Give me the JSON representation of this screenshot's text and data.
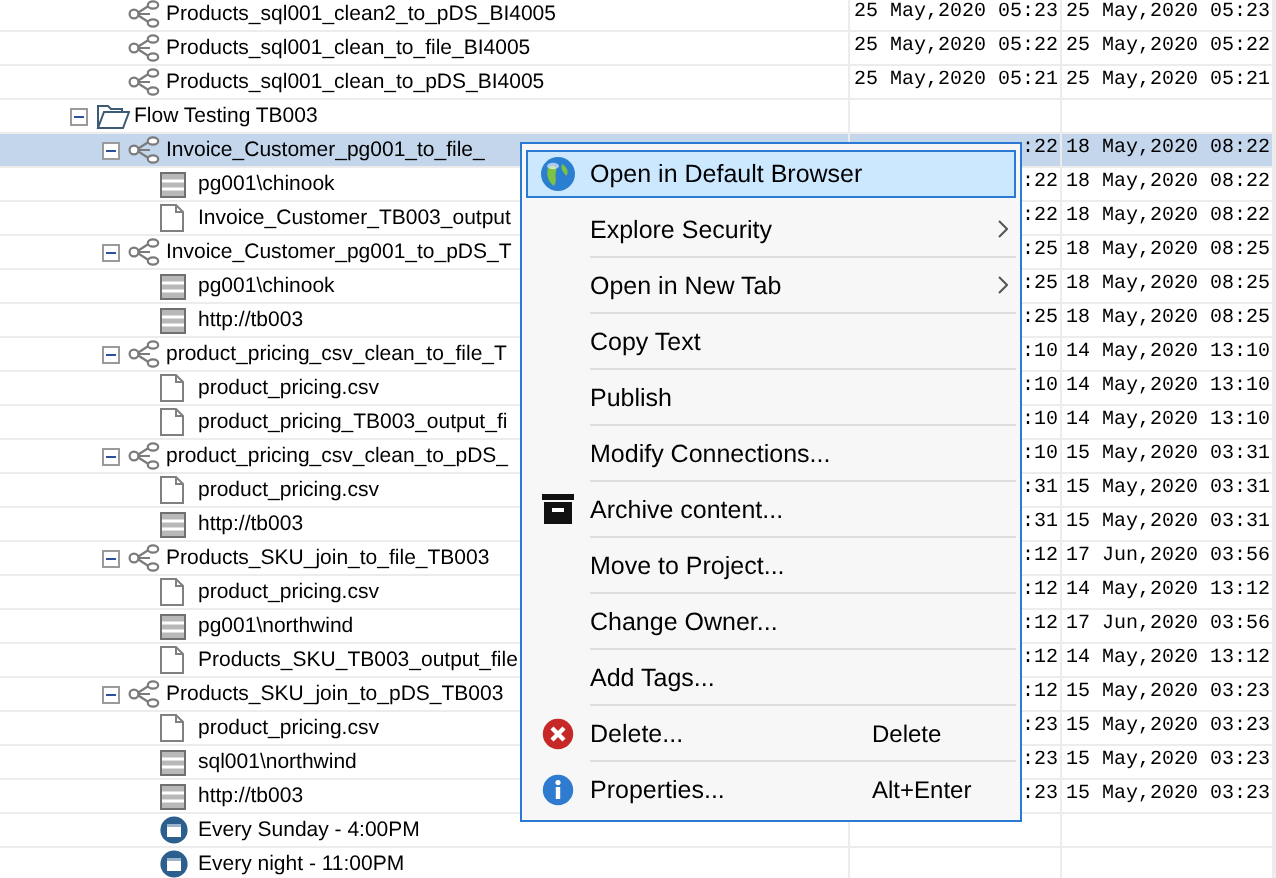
{
  "tree": [
    {
      "children": [
        {
          "kind": "flow",
          "label": "Products_sql001_clean2_to_pDS_BI4005",
          "selected": false,
          "created": "25 May,2020 05:23",
          "modified": "25 May,2020 05:23"
        },
        {
          "kind": "flow",
          "label": "Products_sql001_clean_to_file_BI4005",
          "selected": false,
          "created": "25 May,2020 05:22",
          "modified": "25 May,2020 05:22"
        },
        {
          "kind": "flow",
          "label": "Products_sql001_clean_to_pDS_BI4005",
          "selected": false,
          "created": "25 May,2020 05:21",
          "modified": "25 May,2020 05:21"
        }
      ]
    },
    {
      "kind": "folder",
      "label": "Flow Testing TB003",
      "expanded": true,
      "selected": false,
      "children": [
        {
          "kind": "flow",
          "label": "Invoice_Customer_pg001_to_file_",
          "expanded": true,
          "selected": true,
          "created": ":22",
          "modified": "18 May,2020 08:22",
          "children": [
            {
              "kind": "connection",
              "label": "pg001\\chinook",
              "selected": false,
              "created": ":22",
              "modified": "18 May,2020 08:22"
            },
            {
              "kind": "file",
              "label": "Invoice_Customer_TB003_output",
              "selected": false,
              "created": ":22",
              "modified": "18 May,2020 08:22"
            }
          ]
        },
        {
          "kind": "flow",
          "label": "Invoice_Customer_pg001_to_pDS_T",
          "expanded": true,
          "selected": false,
          "created": ":25",
          "modified": "18 May,2020 08:25",
          "children": [
            {
              "kind": "connection",
              "label": "pg001\\chinook",
              "selected": false,
              "created": ":25",
              "modified": "18 May,2020 08:25"
            },
            {
              "kind": "connection",
              "label": "http://tb003",
              "selected": false,
              "created": ":25",
              "modified": "18 May,2020 08:25"
            }
          ]
        },
        {
          "kind": "flow",
          "label": "product_pricing_csv_clean_to_file_T",
          "expanded": true,
          "selected": false,
          "created": ":10",
          "modified": "14 May,2020 13:10",
          "children": [
            {
              "kind": "file",
              "label": "product_pricing.csv",
              "selected": false,
              "created": ":10",
              "modified": "14 May,2020 13:10"
            },
            {
              "kind": "file",
              "label": "product_pricing_TB003_output_fi",
              "selected": false,
              "created": ":10",
              "modified": "14 May,2020 13:10"
            }
          ]
        },
        {
          "kind": "flow",
          "label": "product_pricing_csv_clean_to_pDS_",
          "expanded": true,
          "selected": false,
          "created": ":10",
          "modified": "15 May,2020 03:31",
          "children": [
            {
              "kind": "file",
              "label": "product_pricing.csv",
              "selected": false,
              "created": ":31",
              "modified": "15 May,2020 03:31"
            },
            {
              "kind": "connection",
              "label": "http://tb003",
              "selected": false,
              "created": ":31",
              "modified": "15 May,2020 03:31"
            }
          ]
        },
        {
          "kind": "flow",
          "label": "Products_SKU_join_to_file_TB003",
          "expanded": true,
          "selected": false,
          "created": ":12",
          "modified": "17 Jun,2020 03:56",
          "children": [
            {
              "kind": "file",
              "label": "product_pricing.csv",
              "selected": false,
              "created": ":12",
              "modified": "14 May,2020 13:12"
            },
            {
              "kind": "connection",
              "label": "pg001\\northwind",
              "selected": false,
              "created": ":12",
              "modified": "17 Jun,2020 03:56"
            },
            {
              "kind": "file",
              "label": "Products_SKU_TB003_output_file",
              "selected": false,
              "created": ":12",
              "modified": "14 May,2020 13:12"
            }
          ]
        },
        {
          "kind": "flow",
          "label": "Products_SKU_join_to_pDS_TB003",
          "expanded": true,
          "selected": false,
          "created": ":12",
          "modified": "15 May,2020 03:23",
          "children": [
            {
              "kind": "file",
              "label": "product_pricing.csv",
              "selected": false,
              "created": ":23",
              "modified": "15 May,2020 03:23"
            },
            {
              "kind": "connection",
              "label": "sql001\\northwind",
              "selected": false,
              "created": ":23",
              "modified": "15 May,2020 03:23"
            },
            {
              "kind": "connection",
              "label": "http://tb003",
              "selected": false,
              "created": ":23",
              "modified": "15 May,2020 03:23"
            },
            {
              "kind": "schedule",
              "label": "Every Sunday - 4:00PM",
              "selected": false
            },
            {
              "kind": "schedule",
              "label": "Every night - 11:00PM",
              "selected": false
            }
          ]
        }
      ]
    }
  ],
  "context_menu": {
    "items": [
      {
        "kind": "open",
        "label": "Open in Default Browser",
        "selected": true,
        "submenu": false
      },
      {
        "kind": "plain",
        "label": "Explore Security",
        "selected": false,
        "submenu": true
      },
      {
        "kind": "plain",
        "label": "Open in New Tab",
        "selected": false,
        "submenu": true
      },
      {
        "kind": "plain",
        "label": "Copy Text",
        "selected": false,
        "submenu": false
      },
      {
        "kind": "plain",
        "label": "Publish",
        "selected": false,
        "submenu": false
      },
      {
        "kind": "plain",
        "label": "Modify Connections...",
        "selected": false,
        "submenu": false
      },
      {
        "kind": "archive",
        "label": "Archive content...",
        "selected": false,
        "submenu": false
      },
      {
        "kind": "plain",
        "label": "Move to Project...",
        "selected": false,
        "submenu": false
      },
      {
        "kind": "plain",
        "label": "Change Owner...",
        "selected": false,
        "submenu": false
      },
      {
        "kind": "plain",
        "label": "Add Tags...",
        "selected": false,
        "submenu": false
      },
      {
        "kind": "delete",
        "label": "Delete...",
        "shortcut": "Delete",
        "selected": false,
        "submenu": false
      },
      {
        "kind": "properties",
        "label": "Properties...",
        "shortcut": "Alt+Enter",
        "selected": false,
        "submenu": false
      }
    ]
  }
}
